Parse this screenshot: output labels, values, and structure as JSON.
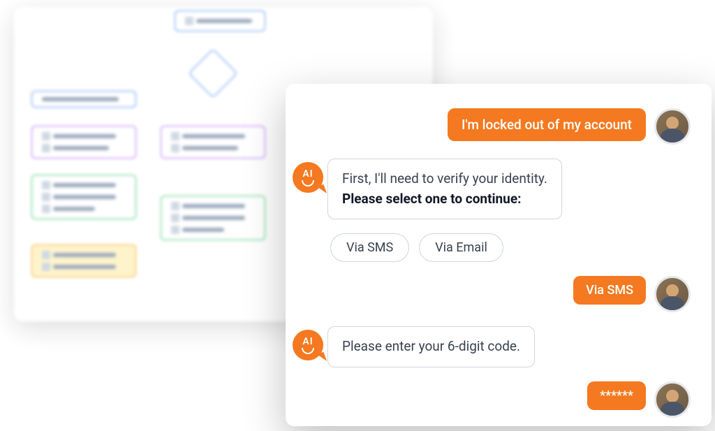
{
  "chat": {
    "user_messages": {
      "msg1": "I'm locked out of my account",
      "msg2": "Via SMS",
      "msg3": "******"
    },
    "bot_messages": {
      "verify_line1": "First, I'll need to verify your identity.",
      "verify_line2": "Please select one to continue:",
      "enter_code": "Please enter your 6-digit code."
    },
    "options": {
      "opt1": "Via SMS",
      "opt2": "Via Email"
    },
    "bot_avatar_label": "AI"
  }
}
